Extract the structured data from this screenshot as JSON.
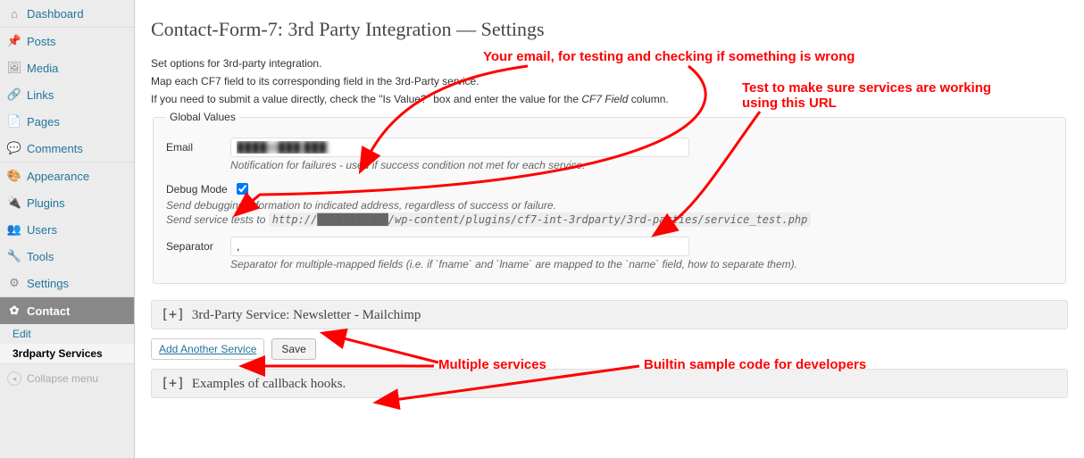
{
  "sidebar": {
    "dashboard": "Dashboard",
    "posts": "Posts",
    "media": "Media",
    "links": "Links",
    "pages": "Pages",
    "comments": "Comments",
    "appearance": "Appearance",
    "plugins": "Plugins",
    "users": "Users",
    "tools": "Tools",
    "settings": "Settings",
    "contact": "Contact",
    "contact_sub_edit": "Edit",
    "contact_sub_services": "3rdparty Services",
    "collapse": "Collapse menu"
  },
  "page": {
    "title": "Contact-Form-7: 3rd Party Integration — Settings",
    "intro1": "Set options for 3rd-party integration.",
    "intro2": "Map each CF7 field to its corresponding field in the 3rd-Party service.",
    "intro3_a": "If you need to submit a value directly, check the \"Is Value?\" box and enter the value for the ",
    "intro3_em": "CF7 Field",
    "intro3_b": " column."
  },
  "global": {
    "legend": "Global Values",
    "email_label": "Email",
    "email_value": "████@███.███",
    "email_help": "Notification for failures - used if success condition not met for each service.",
    "debug_label": "Debug Mode",
    "debug_checked": true,
    "debug_help1": "Send debugging information to indicated address, regardless of success or failure.",
    "debug_help2_a": "Send service tests to ",
    "debug_help2_url": "http://███████████/wp-content/plugins/cf7-int-3rdparty/3rd-parties/service_test.php",
    "separator_label": "Separator",
    "separator_value": ",",
    "separator_help": "Separator for multiple-mapped fields (i.e. if `fname` and `lname` are mapped to the `name` field, how to separate them)."
  },
  "service": {
    "bar1": "3rd-Party Service: Newsletter - Mailchimp",
    "bar2": "Examples of callback hooks.",
    "toggle": "[+]",
    "add": "Add Another Service",
    "save": "Save"
  },
  "anno": {
    "a1": "Your email, for testing and checking if something is wrong",
    "a2_l1": "Test to make sure services are working",
    "a2_l2": "using this URL",
    "a3": "Multiple services",
    "a4": "Builtin sample code for developers"
  }
}
